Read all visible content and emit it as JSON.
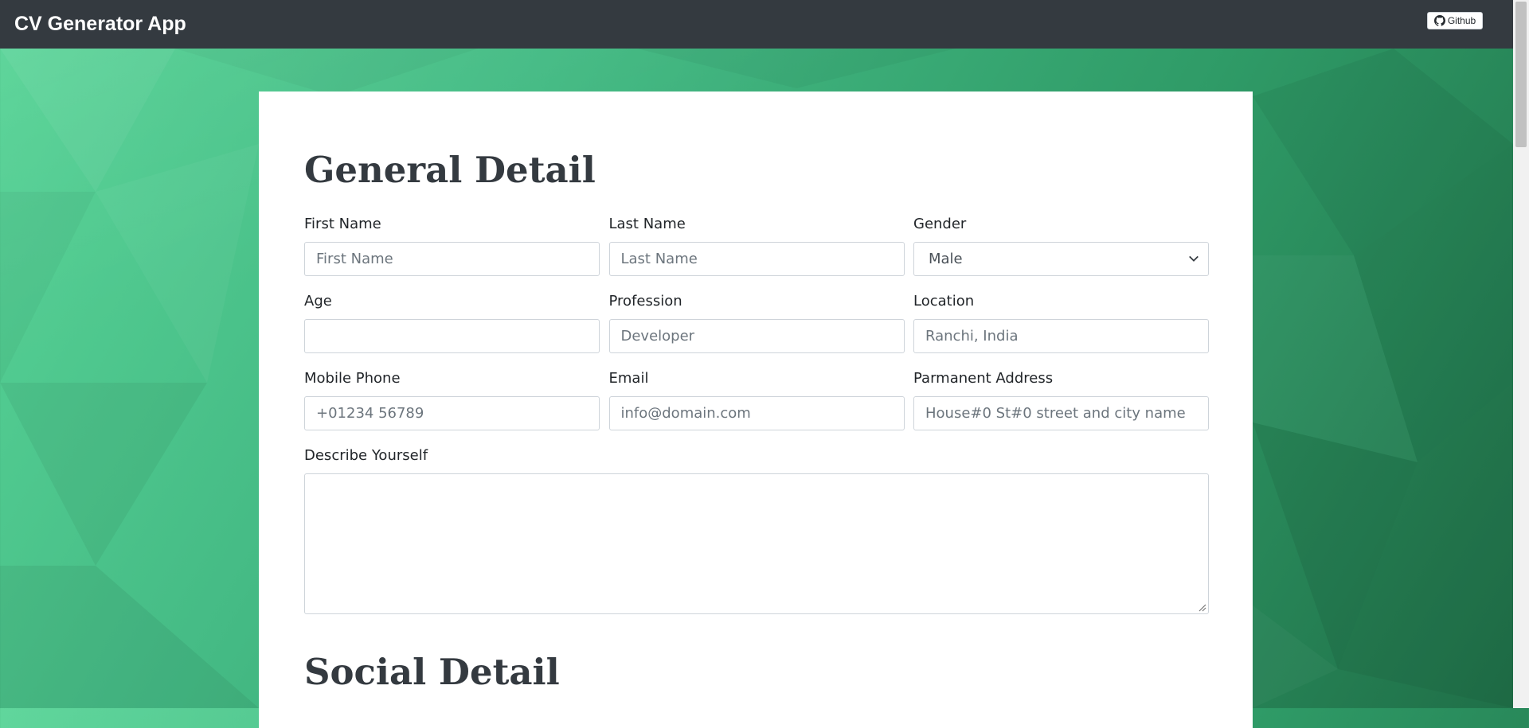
{
  "app": {
    "title": "CV Generator App",
    "github_label": "Github"
  },
  "sections": {
    "general_title": "General Detail",
    "social_title": "Social Detail"
  },
  "fields": {
    "first_name": {
      "label": "First Name",
      "placeholder": "First Name",
      "value": ""
    },
    "last_name": {
      "label": "Last Name",
      "placeholder": "Last Name",
      "value": ""
    },
    "gender": {
      "label": "Gender",
      "selected": "Male"
    },
    "age": {
      "label": "Age",
      "placeholder": "",
      "value": ""
    },
    "profession": {
      "label": "Profession",
      "placeholder": "Developer",
      "value": ""
    },
    "location": {
      "label": "Location",
      "placeholder": "Ranchi, India",
      "value": ""
    },
    "mobile": {
      "label": "Mobile Phone",
      "placeholder": "+01234 56789",
      "value": ""
    },
    "email": {
      "label": "Email",
      "placeholder": "info@domain.com",
      "value": ""
    },
    "address": {
      "label": "Parmanent Address",
      "placeholder": "House#0 St#0 street and city name",
      "value": ""
    },
    "describe": {
      "label": "Describe Yourself",
      "value": ""
    }
  },
  "icons": {
    "github": "github-icon",
    "select_chevron": "chevron-down-icon",
    "resize": "resize-grip-icon"
  },
  "colors": {
    "navbar": "#343a40",
    "background_light": "#58d497",
    "background_dark": "#1f6e47",
    "card": "#ffffff",
    "heading": "#343a40"
  }
}
